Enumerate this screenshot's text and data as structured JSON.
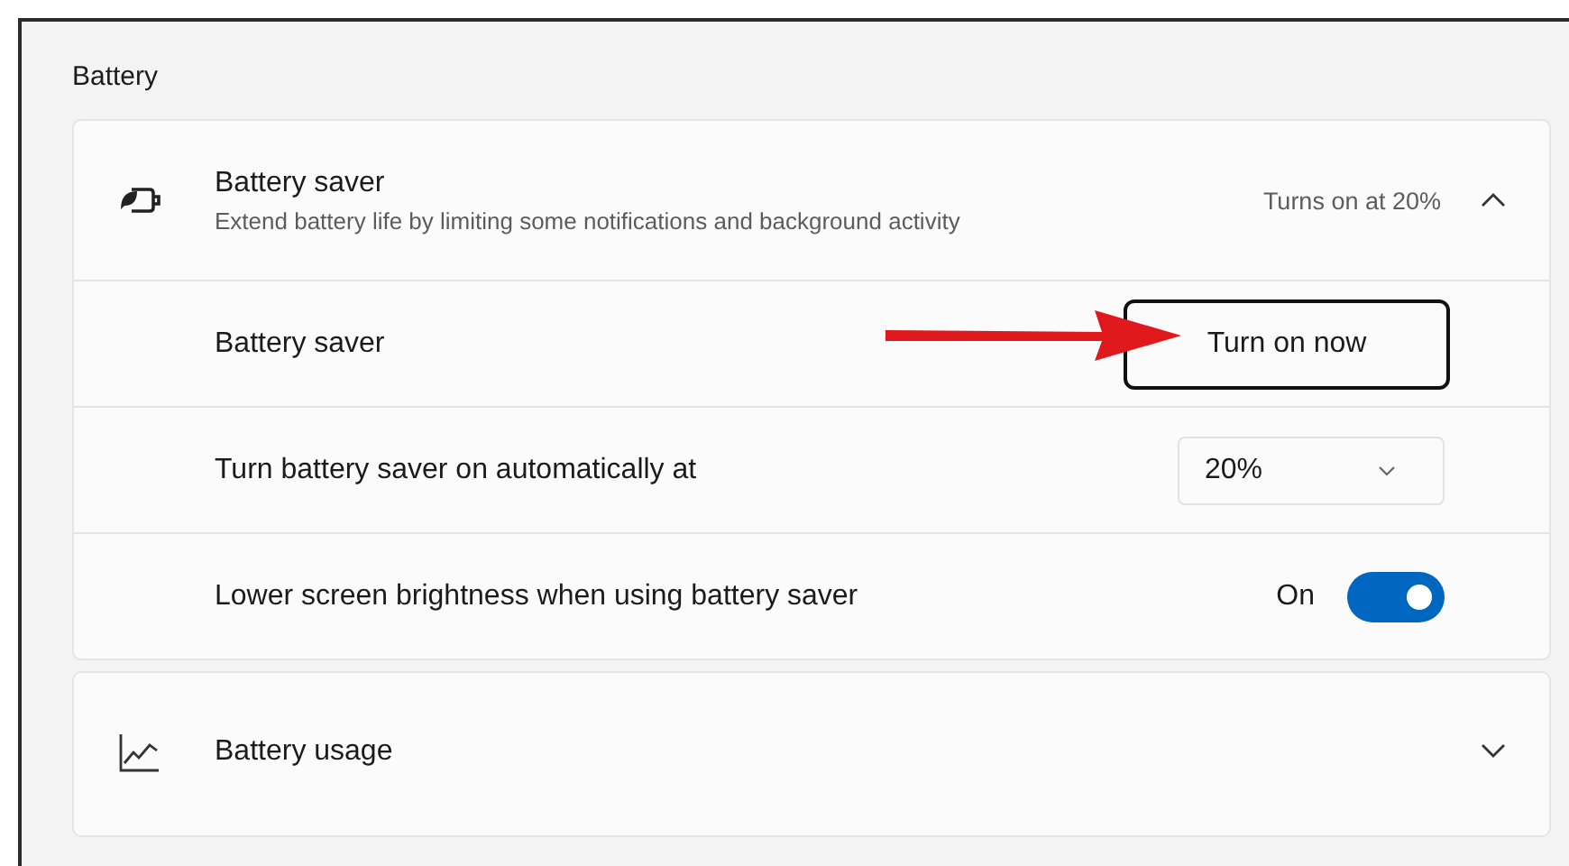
{
  "section_title": "Battery",
  "battery_saver": {
    "title": "Battery saver",
    "description": "Extend battery life by limiting some notifications and background activity",
    "status": "Turns on at 20%",
    "expanded": true,
    "rows": [
      {
        "kind": "button",
        "label": "Battery saver",
        "button": "Turn on now"
      },
      {
        "kind": "dropdown",
        "label": "Turn battery saver on automatically at",
        "value": "20%"
      },
      {
        "kind": "toggle",
        "label": "Lower screen brightness when using battery saver",
        "state_text": "On",
        "on": true
      }
    ]
  },
  "battery_usage": {
    "title": "Battery usage",
    "expanded": false
  }
}
